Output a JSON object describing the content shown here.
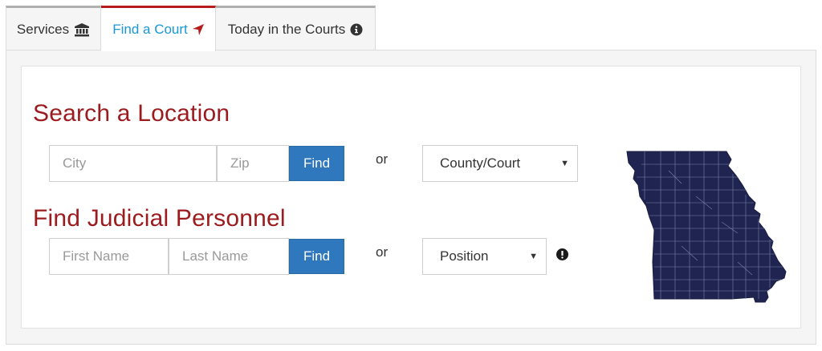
{
  "tabs": [
    {
      "label": "Services",
      "icon": "bank-icon"
    },
    {
      "label": "Find a Court",
      "icon": "location-arrow-icon"
    },
    {
      "label": "Today in the Courts",
      "icon": "info-circle-icon"
    }
  ],
  "location": {
    "heading": "Search a Location",
    "city_placeholder": "City",
    "zip_placeholder": "Zip",
    "find_label": "Find",
    "or_label": "or",
    "county_select": "County/Court"
  },
  "personnel": {
    "heading": "Find Judicial Personnel",
    "first_placeholder": "First Name",
    "last_placeholder": "Last Name",
    "find_label": "Find",
    "or_label": "or",
    "position_select": "Position",
    "info_icon": "exclamation-circle-icon"
  },
  "map": {
    "icon": "missouri-counties-map-icon"
  },
  "colors": {
    "heading": "#9b1b1f",
    "active_tab_text": "#1a97d4",
    "active_tab_border": "#b71c1c",
    "button": "#2f78bd",
    "map_fill": "#1f2451"
  }
}
